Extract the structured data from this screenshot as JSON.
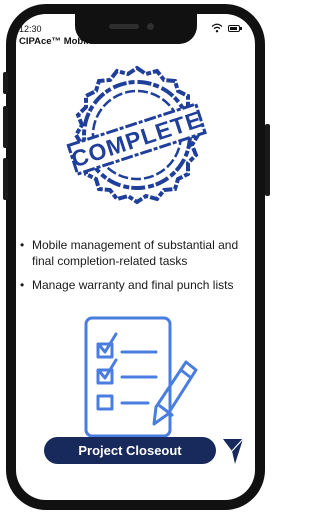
{
  "status_bar": {
    "time": "12:30",
    "wifi_icon": "wifi-icon",
    "battery_icon": "battery-icon"
  },
  "app": {
    "title": "CIPAce™ Mobile"
  },
  "stamp": {
    "text": "COMPLETE",
    "color": "#1f3f9a"
  },
  "bullets": [
    "Mobile management of substantial and final completion-related tasks",
    "Manage warranty and final punch lists"
  ],
  "illustration": {
    "icon": "checklist-pencil-icon",
    "color": "#4a7de0"
  },
  "footer": {
    "button_label": "Project Closeout",
    "button_color": "#182a5c",
    "send_icon": "send-icon"
  }
}
